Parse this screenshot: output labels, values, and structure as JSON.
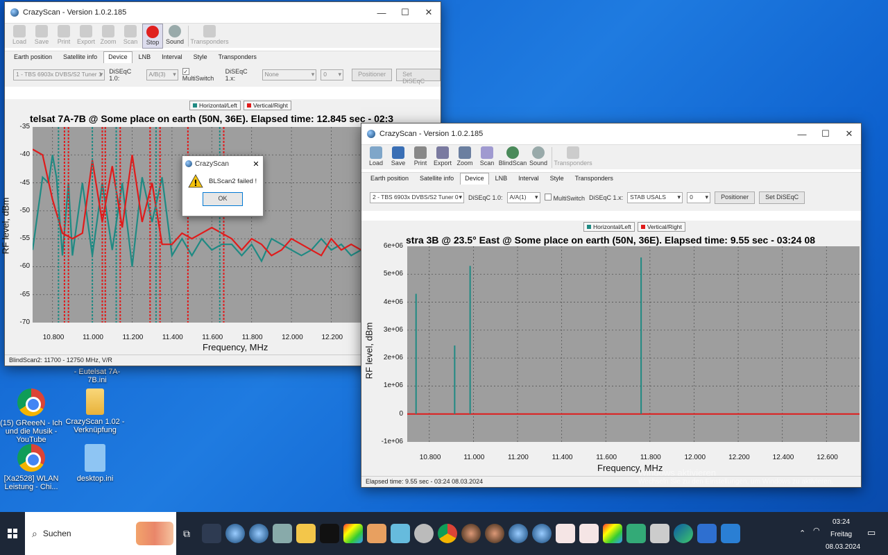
{
  "desktop": {
    "icons": [
      {
        "label": "(15) GReeeN - Ich und die Musik - YouTube"
      },
      {
        "label": "CrazyScan 1.02 - Verknüpfung"
      },
      {
        "label": "[Xa2528] WLAN Leistung - Chi..."
      },
      {
        "label": "desktop.ini"
      },
      {
        "label": "- Eutelsat 7A-7B.ini"
      }
    ],
    "watermark": {
      "line1": "Windows aktivieren",
      "line2": "Wechseln Sie zu den Einstellungen, um Windows zu aktivieren."
    }
  },
  "window1": {
    "title": "CrazyScan - Version 1.0.2.185",
    "toolbar": [
      "Load",
      "Save",
      "Print",
      "Export",
      "Zoom",
      "Scan",
      "Stop",
      "Sound",
      "Transponders"
    ],
    "tabs": [
      "Earth position",
      "Satellite info",
      "Device",
      "LNB",
      "Interval",
      "Style",
      "Transponders"
    ],
    "tuner": "1 - TBS 6903x DVBS/S2 Tuner 1",
    "diseqc10_label": "DiSEqC 1.0:",
    "diseqc10": "A/B(3)",
    "multiswitch": "MultiSwitch",
    "diseqc1x_label": "DiSEqC 1.x:",
    "diseqc1x": "None",
    "spin": "0",
    "positioner": "Positioner",
    "set_diseqc": "Set DiSEqC",
    "legend": [
      "Horizontal/Left",
      "Vertical/Right"
    ],
    "chart_title": "telsat 7A-7B @ Some place on earth (50N, 36E). Elapsed time: 12.845 sec - 02:3",
    "status": "BlindScan2: 11700 - 12750 MHz, V/R"
  },
  "dialog": {
    "title": "CrazyScan",
    "message": "BLScan2 failed !",
    "ok": "OK"
  },
  "window2": {
    "title": "CrazyScan - Version 1.0.2.185",
    "toolbar": [
      "Load",
      "Save",
      "Print",
      "Export",
      "Zoom",
      "Scan",
      "BlindScan",
      "Sound",
      "Transponders"
    ],
    "tabs": [
      "Earth position",
      "Satellite info",
      "Device",
      "LNB",
      "Interval",
      "Style",
      "Transponders"
    ],
    "tuner": "2 - TBS 6903x DVBS/S2 Tuner 0",
    "diseqc10_label": "DiSEqC 1.0:",
    "diseqc10": "A/A(1)",
    "multiswitch": "MultiSwitch",
    "diseqc1x_label": "DiSEqC 1.x:",
    "diseqc1x": "STAB USALS",
    "spin": "0",
    "positioner": "Positioner",
    "set_diseqc": "Set DiSEqC",
    "legend": [
      "Horizontal/Left",
      "Vertical/Right"
    ],
    "chart_title": "stra 3B @ 23.5° East @ Some place on earth (50N, 36E). Elapsed time: 9.55 sec - 03:24 08",
    "status": "Elapsed time: 9.55 sec - 03:24 08.03.2024"
  },
  "taskbar": {
    "search": "Suchen",
    "time": "03:24",
    "day": "Freitag",
    "date": "08.03.2024"
  },
  "colors": {
    "horizontal": "#1f8a83",
    "vertical": "#e01b1b"
  },
  "chart_data": [
    {
      "type": "line",
      "title": "telsat 7A-7B @ Some place on earth (50N, 36E). Elapsed time: 12.845 sec - 02:3",
      "xlabel": "Frequency, MHz",
      "ylabel": "RF level, dBm",
      "xlim": [
        10700,
        12700
      ],
      "ylim": [
        -70,
        -35
      ],
      "xticks": [
        "10.800",
        "11.000",
        "11.200",
        "11.400",
        "11.600",
        "11.800",
        "12.000",
        "12.200",
        "12"
      ],
      "yticks": [
        "-35",
        "-40",
        "-45",
        "-50",
        "-55",
        "-60",
        "-65",
        "-70"
      ],
      "grid": true,
      "series": [
        {
          "name": "Horizontal/Left",
          "x": [
            10700,
            10750,
            10780,
            10800,
            10820,
            10850,
            10880,
            10900,
            10950,
            11000,
            11050,
            11100,
            11150,
            11200,
            11250,
            11300,
            11350,
            11400,
            11450,
            11500,
            11550,
            11600,
            11650,
            11700,
            11750,
            11800,
            11850,
            11900,
            11950,
            12000,
            12050,
            12100,
            12150,
            12200,
            12250,
            12300,
            12350
          ],
          "y": [
            -57,
            -44,
            -45,
            -40,
            -44,
            -58,
            -45,
            -58,
            -45,
            -58,
            -45,
            -57,
            -45,
            -60,
            -44,
            -52,
            -44,
            -58,
            -55,
            -58,
            -55,
            -57,
            -56,
            -56,
            -58,
            -56,
            -59,
            -55,
            -56,
            -57,
            -58,
            -57,
            -55,
            -57,
            -56,
            -58,
            -57
          ]
        },
        {
          "name": "Vertical/Right",
          "x": [
            10700,
            10750,
            10800,
            10850,
            10900,
            10950,
            11000,
            11050,
            11100,
            11150,
            11200,
            11250,
            11300,
            11350,
            11400,
            11450,
            11500,
            11550,
            11600,
            11650,
            11700,
            11750,
            11800,
            11850,
            11900,
            11950,
            12000,
            12050,
            12100,
            12150,
            12200,
            12250,
            12300,
            12350
          ],
          "y": [
            -39,
            -40,
            -48,
            -54,
            -55,
            -54,
            -41,
            -52,
            -42,
            -53,
            -40,
            -52,
            -45,
            -56,
            -56,
            -54,
            -55,
            -54,
            -53,
            -54,
            -55,
            -57,
            -55,
            -56,
            -58,
            -57,
            -55,
            -56,
            -57,
            -58,
            -55,
            -57,
            -56,
            -57
          ]
        }
      ]
    },
    {
      "type": "bar",
      "title": "stra 3B @ 23.5° East @ Some place on earth (50N, 36E). Elapsed time: 9.55 sec - 03:24 08",
      "xlabel": "Frequency, MHz",
      "ylabel": "RF level, dBm",
      "xlim": [
        10700,
        12750
      ],
      "ylim": [
        -1000000,
        6000000
      ],
      "xticks": [
        "10.800",
        "11.000",
        "11.200",
        "11.400",
        "11.600",
        "11.800",
        "12.000",
        "12.200",
        "12.400",
        "12.600"
      ],
      "yticks": [
        "6e+06",
        "5e+06",
        "4e+06",
        "3e+06",
        "2e+06",
        "1e+06",
        "0",
        "-1e+06"
      ],
      "grid": true,
      "series": [
        {
          "name": "Horizontal/Left",
          "x": [
            10740,
            10915,
            10985,
            11760
          ],
          "values": [
            4300000,
            2450000,
            5300000,
            5600000
          ]
        },
        {
          "name": "Vertical/Right",
          "x": [
            10700,
            12750
          ],
          "values": [
            0,
            0
          ]
        }
      ]
    }
  ]
}
